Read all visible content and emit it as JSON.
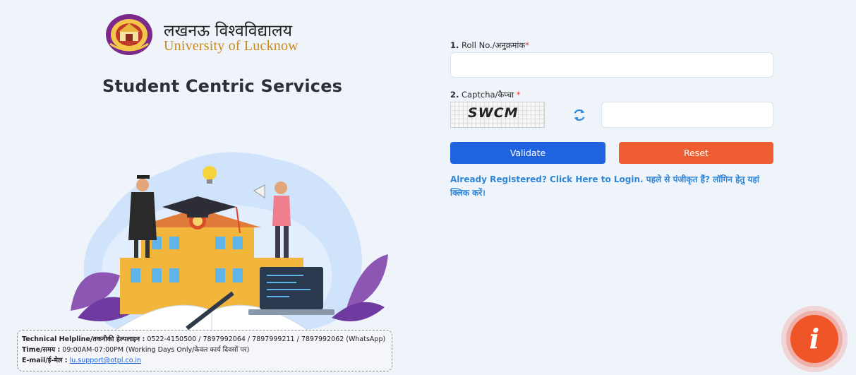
{
  "brand": {
    "name_hi": "लखनऊ विश्वविद्यालय",
    "name_en": "University of Lucknow"
  },
  "page": {
    "subtitle": "Student Centric Services"
  },
  "form": {
    "roll_no": {
      "number": "1.",
      "label": " Roll No./अनुक्रमांक",
      "required": "*",
      "value": "",
      "placeholder": ""
    },
    "captcha": {
      "number": "2.",
      "label": " Captcha/कैप्चा ",
      "required": "*",
      "image_text": "SWCM",
      "value": "",
      "placeholder": ""
    },
    "validate_label": "Validate",
    "reset_label": "Reset",
    "login_link": "Already Registered? Click Here to Login. पहले से पंजीकृत हैं? लॉगिन हेतु यहां क्लिक करें।"
  },
  "contact": {
    "helpline_label": "Technical Helpline/तकनीकी हेल्पलाइन :",
    "helpline_value": " 0522-4150500 / 7897992064 / 7897999211 / 7897992062 (WhatsApp)",
    "time_label": "Time/समय :",
    "time_value": " 09:00AM-07:00PM (Working Days Only/केवल कार्य दिवसों पर)",
    "email_label": "E-mail/ई-मेल :",
    "email_value": "lu.support@otpl.co.in"
  },
  "colors": {
    "validate": "#1f63e0",
    "reset": "#ef5e32",
    "link": "#2f86d6",
    "info_fab": "#ef5526"
  },
  "icons": {
    "refresh": "refresh-icon",
    "info": "info-icon"
  },
  "fab": {
    "glyph": "i"
  }
}
